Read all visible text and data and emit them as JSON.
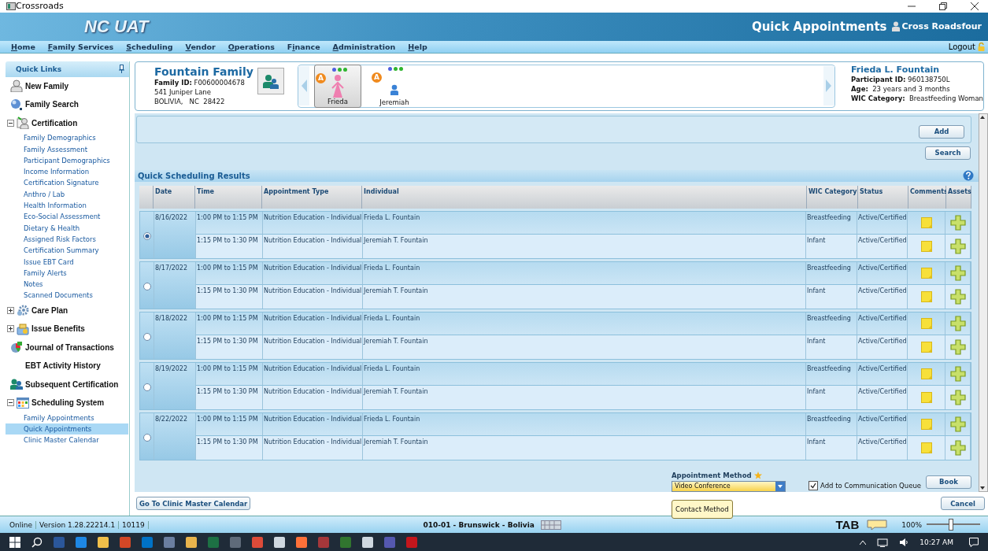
{
  "window": {
    "title": "Crossroads"
  },
  "header": {
    "environment": "NC UAT",
    "page_title": "Quick Appointments",
    "user": "Cross Roadsfour"
  },
  "menu": [
    {
      "key": "H",
      "rest": "ome"
    },
    {
      "key": "F",
      "rest": "amily Services"
    },
    {
      "key": "S",
      "rest": "cheduling"
    },
    {
      "key": "V",
      "rest": "endor"
    },
    {
      "key": "O",
      "rest": "perations"
    },
    {
      "lead": "F",
      "key": "i",
      "rest": "nance"
    },
    {
      "key": "A",
      "rest": "dministration"
    },
    {
      "key": "H",
      "rest": "elp"
    }
  ],
  "logout": "Logout",
  "sidebar": {
    "title": "Quick Links",
    "items": [
      {
        "kind": "link",
        "label": "New Family"
      },
      {
        "kind": "link",
        "label": "Family Search"
      },
      {
        "kind": "group",
        "label": "Certification",
        "expanded": true,
        "children": [
          {
            "label": "Family Demographics",
            "selected": false
          },
          {
            "label": "Family Assessment",
            "selected": false
          },
          {
            "label": "Participant Demographics",
            "selected": false
          },
          {
            "label": "Income Information",
            "selected": false
          },
          {
            "label": "Certification Signature",
            "selected": false
          },
          {
            "label": "Anthro / Lab",
            "selected": false
          },
          {
            "label": "Health Information",
            "selected": false
          },
          {
            "label": "Eco-Social Assessment",
            "selected": false
          },
          {
            "label": "Dietary & Health",
            "selected": false
          },
          {
            "label": "Assigned Risk Factors",
            "selected": false
          },
          {
            "label": "Certification Summary",
            "selected": false
          },
          {
            "label": "Issue EBT Card",
            "selected": false
          },
          {
            "label": "Family Alerts",
            "selected": false
          },
          {
            "label": "Notes",
            "selected": false
          },
          {
            "label": "Scanned Documents",
            "selected": false
          }
        ]
      },
      {
        "kind": "group",
        "label": "Care Plan",
        "expanded": false
      },
      {
        "kind": "group",
        "label": "Issue Benefits",
        "expanded": false
      },
      {
        "kind": "link",
        "label": "Journal of Transactions"
      },
      {
        "kind": "link",
        "label": "EBT Activity History"
      },
      {
        "kind": "link",
        "label": "Subsequent Certification"
      },
      {
        "kind": "group",
        "label": "Scheduling System",
        "expanded": true,
        "children": [
          {
            "label": "Family Appointments",
            "selected": false
          },
          {
            "label": "Quick Appointments",
            "selected": true
          },
          {
            "label": "Clinic Master Calendar",
            "selected": false
          }
        ]
      }
    ]
  },
  "family": {
    "name": "Fountain Family",
    "family_id": "**Family ID:** F00600004678",
    "address": [
      "541 Juniper Lane",
      "BOLIVIA,   NC  28422"
    ],
    "participants": [
      {
        "name": "Frieda",
        "kind": "woman",
        "badge": "A",
        "selected": true,
        "dots": [
          {
            "color": "#4f5fe0"
          },
          {
            "color": "#2fb52f"
          },
          {
            "color": "#2fb52f"
          }
        ]
      },
      {
        "name": "Jeremiah",
        "kind": "infant",
        "badge": "A",
        "selected": false,
        "dots": [
          {
            "color": "#4f5fe0"
          },
          {
            "color": "#2fb52f"
          },
          {
            "color": "#2fb52f"
          }
        ]
      }
    ],
    "participant": {
      "name": "Frieda L. Fountain",
      "fields": [
        "**Participant ID:** 960138750L",
        "**Age:**  23 years and 3 months",
        "**WIC Category:**  Breastfeeding Woman"
      ]
    }
  },
  "search_panel": {
    "buttons": [
      "Add",
      "Search"
    ]
  },
  "results": {
    "title": "Quick Scheduling Results",
    "columns": [
      "Date",
      "Time",
      "Appointment Type",
      "Individual",
      "WIC Category",
      "Status",
      "Comments",
      "Assets"
    ],
    "groups": [
      {
        "date": "8/16/2022",
        "selected": true,
        "rows": [
          {
            "time": "1:00 PM to 1:15 PM",
            "type": "Nutrition Education - Individual",
            "individual": "Frieda L. Fountain",
            "wic_category": "Breastfeeding",
            "status": "Active/Certified"
          },
          {
            "time": "1:15 PM to 1:30 PM",
            "type": "Nutrition Education - Individual",
            "individual": "Jeremiah T. Fountain",
            "wic_category": "Infant",
            "status": "Active/Certified"
          }
        ]
      },
      {
        "date": "8/17/2022",
        "selected": false,
        "rows": [
          {
            "time": "1:00 PM to 1:15 PM",
            "type": "Nutrition Education - Individual",
            "individual": "Frieda L. Fountain",
            "wic_category": "Breastfeeding",
            "status": "Active/Certified"
          },
          {
            "time": "1:15 PM to 1:30 PM",
            "type": "Nutrition Education - Individual",
            "individual": "Jeremiah T. Fountain",
            "wic_category": "Infant",
            "status": "Active/Certified"
          }
        ]
      },
      {
        "date": "8/18/2022",
        "selected": false,
        "rows": [
          {
            "time": "1:00 PM to 1:15 PM",
            "type": "Nutrition Education - Individual",
            "individual": "Frieda L. Fountain",
            "wic_category": "Breastfeeding",
            "status": "Active/Certified"
          },
          {
            "time": "1:15 PM to 1:30 PM",
            "type": "Nutrition Education - Individual",
            "individual": "Jeremiah T. Fountain",
            "wic_category": "Infant",
            "status": "Active/Certified"
          }
        ]
      },
      {
        "date": "8/19/2022",
        "selected": false,
        "rows": [
          {
            "time": "1:00 PM to 1:15 PM",
            "type": "Nutrition Education - Individual",
            "individual": "Frieda L. Fountain",
            "wic_category": "Breastfeeding",
            "status": "Active/Certified"
          },
          {
            "time": "1:15 PM to 1:30 PM",
            "type": "Nutrition Education - Individual",
            "individual": "Jeremiah T. Fountain",
            "wic_category": "Infant",
            "status": "Active/Certified"
          }
        ]
      },
      {
        "date": "8/22/2022",
        "selected": false,
        "rows": [
          {
            "time": "1:00 PM to 1:15 PM",
            "type": "Nutrition Education - Individual",
            "individual": "Frieda L. Fountain",
            "wic_category": "Breastfeeding",
            "status": "Active/Certified"
          },
          {
            "time": "1:15 PM to 1:30 PM",
            "type": "Nutrition Education - Individual",
            "individual": "Jeremiah T. Fountain",
            "wic_category": "Infant",
            "status": "Active/Certified"
          }
        ]
      }
    ]
  },
  "booking": {
    "method_label": "Appointment Method",
    "method_value": "Video Conference",
    "tooltip": "Contact Method",
    "queue_label": "Add to Communication Queue",
    "queue_checked": true,
    "book": "Book"
  },
  "footer_buttons": [
    "Go To Clinic Master Calendar",
    "Cancel"
  ],
  "status_bar": {
    "cells": [
      "Online",
      "Version 1.28.22214.1",
      "10119"
    ],
    "location": "010-01 - Brunswick - Bolivia",
    "tab": "TAB",
    "zoom": "100%",
    "zoom_level": {
      "level": 0.45
    }
  },
  "taskbar": {
    "time": "10:27 AM"
  }
}
